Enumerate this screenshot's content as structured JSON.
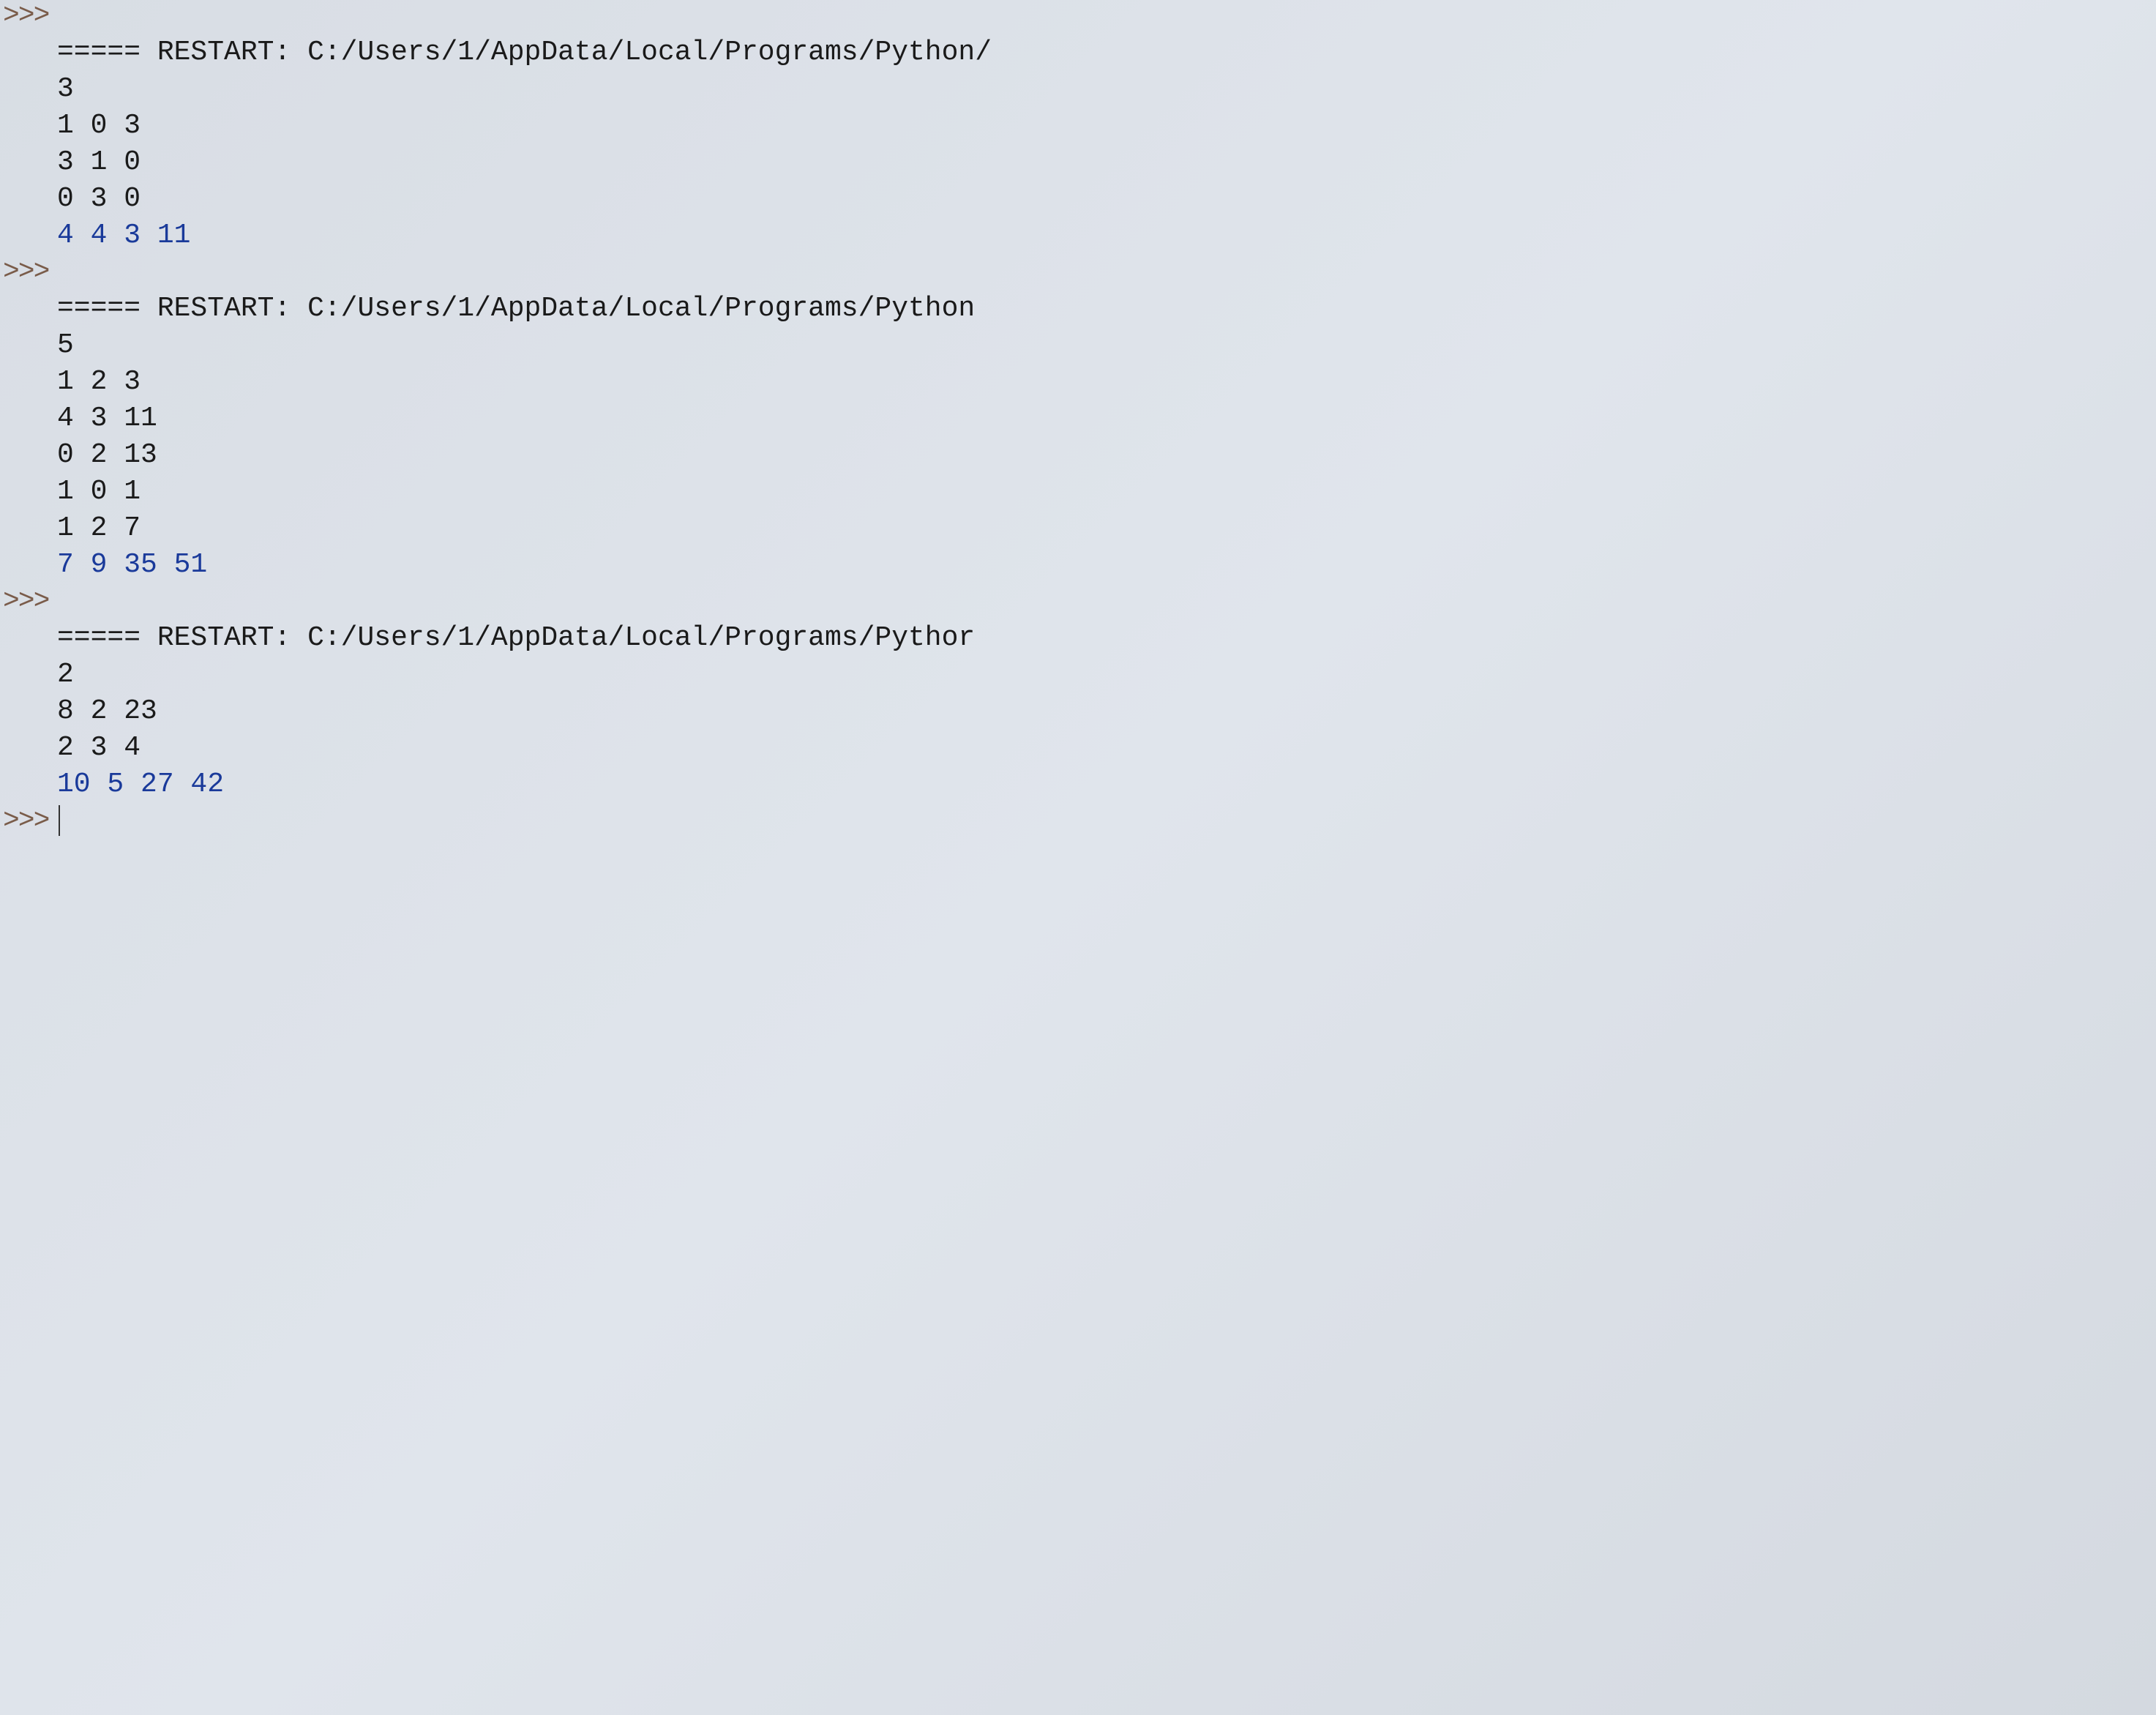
{
  "prompt_symbol": ">>>",
  "restart_prefix": "===== RESTART: ",
  "restart_path1": "C:/Users/1/AppData/Local/Programs/Python/",
  "restart_path2": "C:/Users/1/AppData/Local/Programs/Python",
  "restart_path3": "C:/Users/1/AppData/Local/Programs/Pythor",
  "session1": {
    "lines": [
      "3",
      "1 0 3",
      "3 1 0",
      "0 3 0"
    ],
    "result": "4 4 3 11"
  },
  "session2": {
    "lines": [
      "5",
      "1 2 3",
      "4 3 11",
      "0 2 13",
      "1 0 1",
      "1 2 7"
    ],
    "result": "7 9 35 51"
  },
  "session3": {
    "lines": [
      "2",
      "8 2 23",
      "2 3 4"
    ],
    "result": "10 5 27 42"
  }
}
